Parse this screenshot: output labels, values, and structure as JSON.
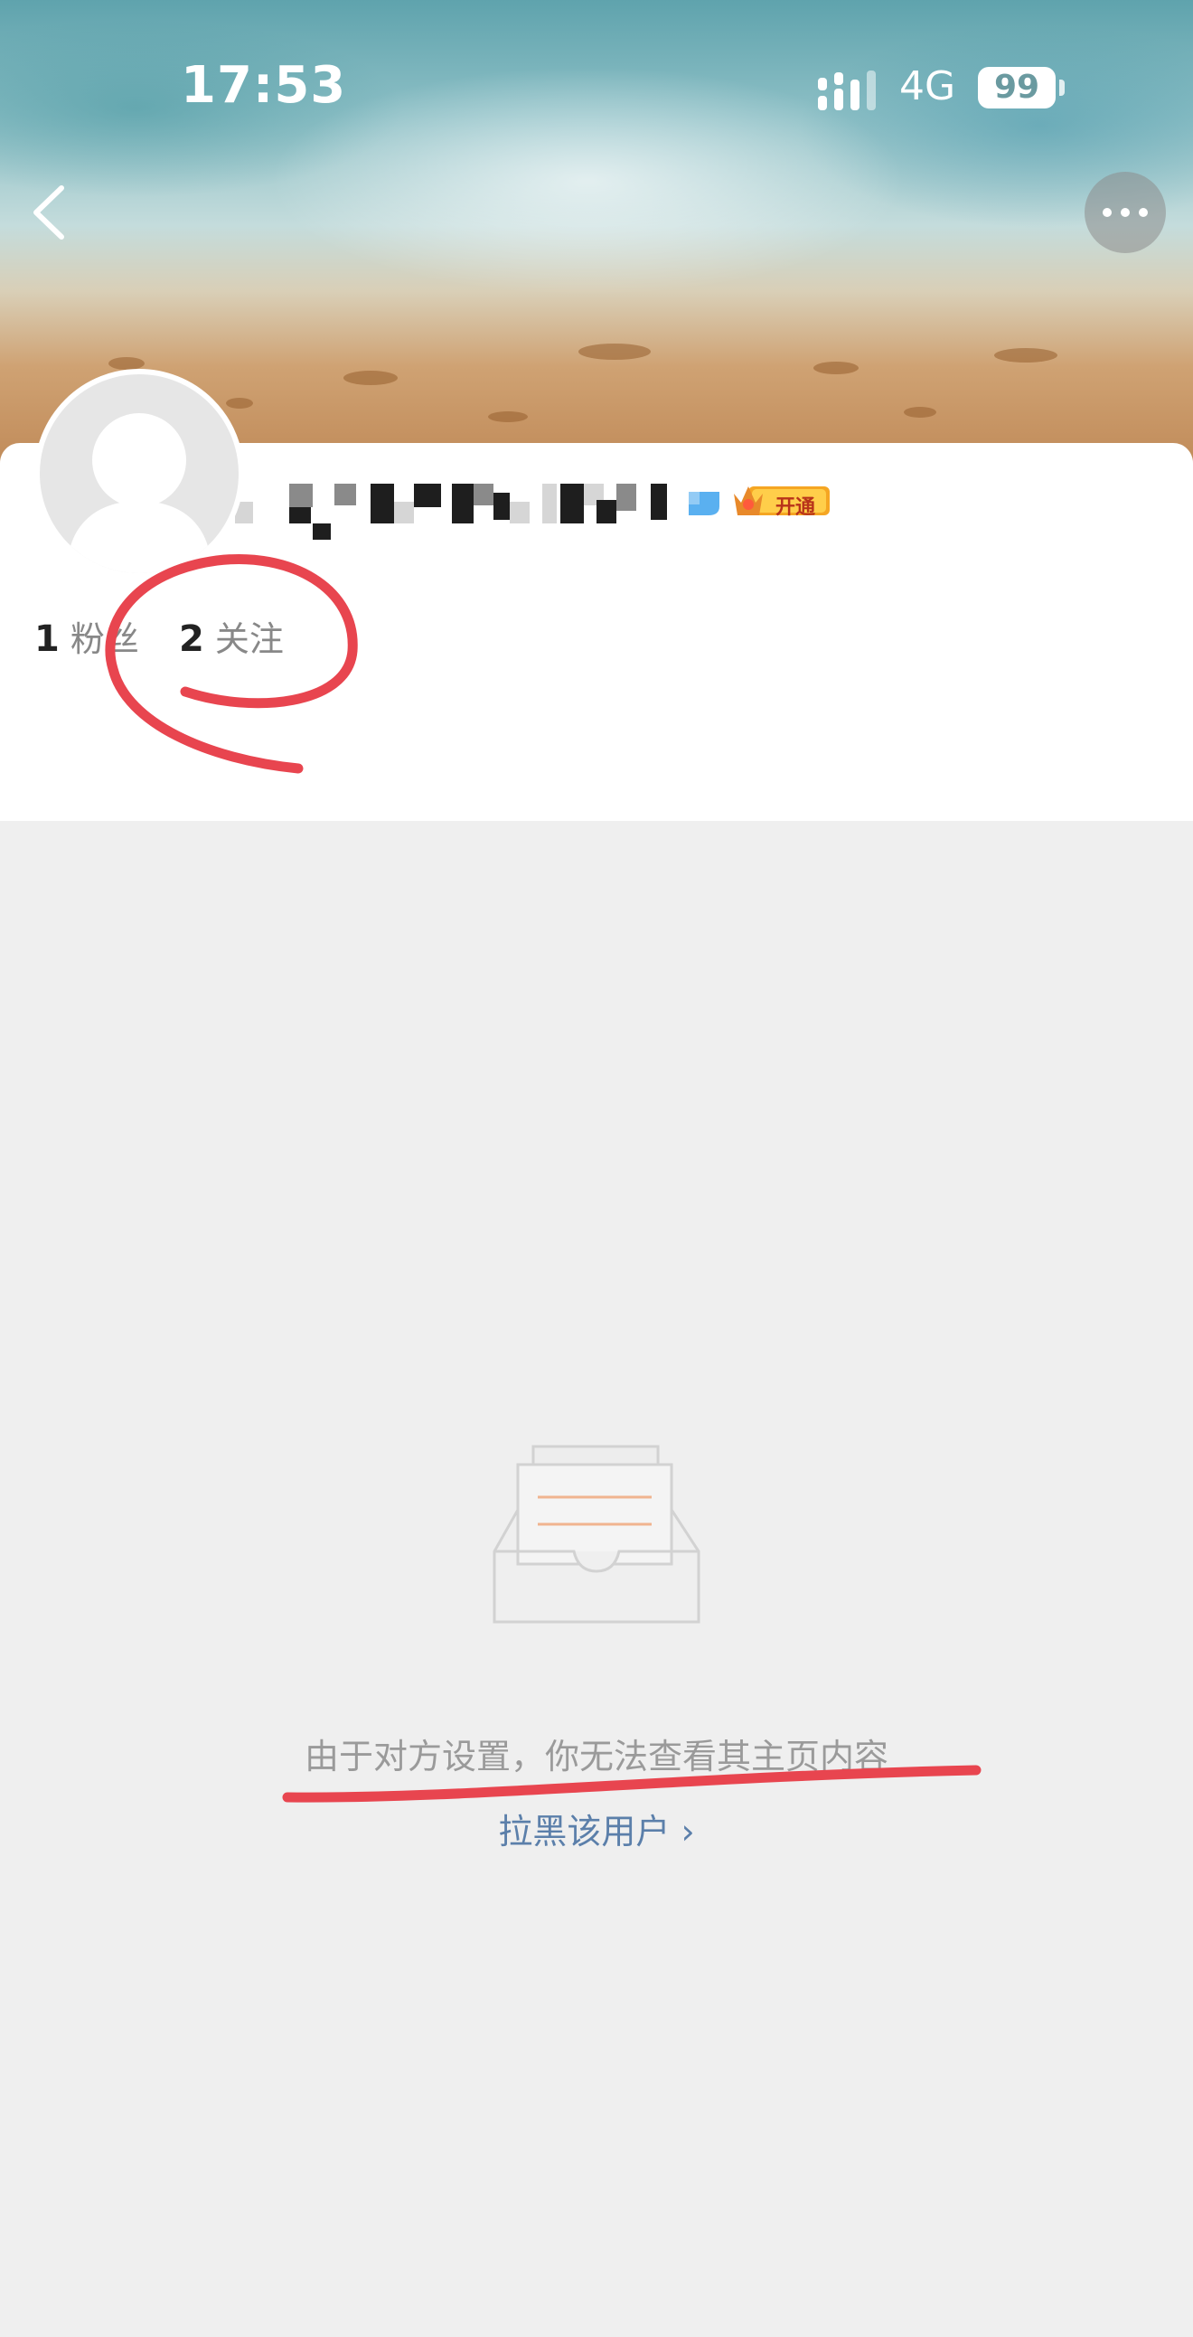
{
  "status_bar": {
    "time": "17:53",
    "network": "4G",
    "battery": "99"
  },
  "nav": {
    "back_icon": "chevron-left-icon",
    "more_icon": "more-dots-icon"
  },
  "profile": {
    "avatar_icon": "default-avatar-icon",
    "vip_label": "开通",
    "followers_count": "1",
    "followers_label": "粉丝",
    "following_count": "2",
    "following_label": "关注"
  },
  "empty_state": {
    "icon": "empty-inbox-icon",
    "message": "由于对方设置，你无法查看其主页内容",
    "block_link": "拉黑该用户 ›"
  },
  "colors": {
    "link": "#5b7faa",
    "annotation": "#e8454f",
    "muted_text": "#9a9a9a",
    "page_bg": "#efefef"
  }
}
